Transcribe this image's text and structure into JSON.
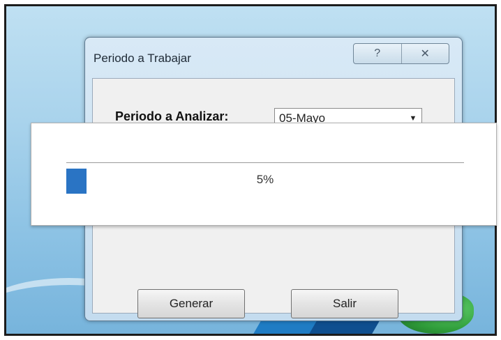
{
  "dialog": {
    "title": "Periodo a Trabajar",
    "help_symbol": "?",
    "close_symbol": "✕"
  },
  "form": {
    "period_label": "Periodo a Analizar:",
    "period_value": "05-Mayo",
    "dropdown_arrow": "▼"
  },
  "progress": {
    "percent": 5,
    "text": "5%",
    "color": "#2a74c4"
  },
  "buttons": {
    "generar": "Generar",
    "salir": "Salir"
  }
}
